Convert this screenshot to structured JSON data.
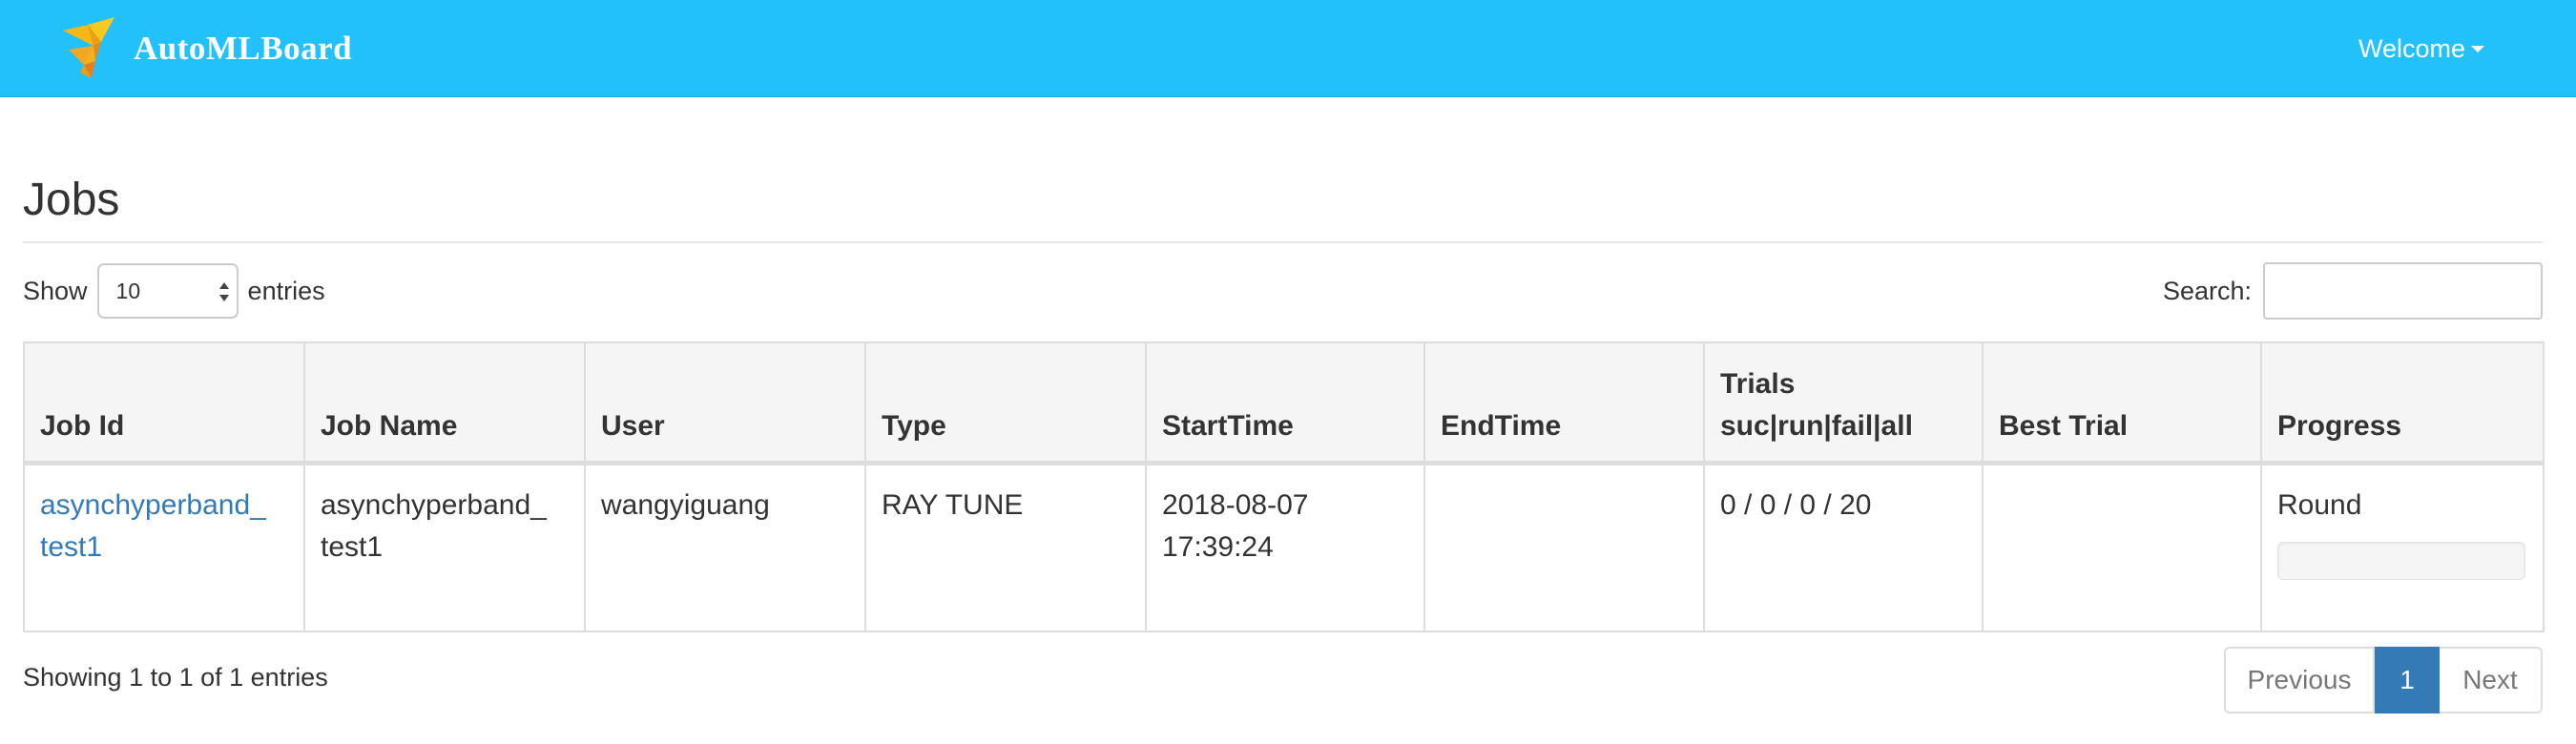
{
  "navbar": {
    "brand": "AutoMLBoard",
    "logo_icon": "paper-crane-icon",
    "welcome": "Welcome",
    "colors": {
      "background": "#22c1fb",
      "text": "#ffffff"
    }
  },
  "page": {
    "title": "Jobs"
  },
  "controls": {
    "show_label": "Show",
    "entries_value": "10",
    "entries_label": "entries",
    "search_label": "Search:",
    "search_value": ""
  },
  "table": {
    "headers": {
      "job_id": "Job Id",
      "job_name": "Job Name",
      "user": "User",
      "type": "Type",
      "start_time": "StartTime",
      "end_time": "EndTime",
      "trials_line1": "Trials",
      "trials_line2": "suc|run|fail|all",
      "best_trial": "Best Trial",
      "progress": "Progress"
    },
    "rows": [
      {
        "job_id_line1": "asynchyperband_",
        "job_id_line2": "test1",
        "job_name_line1": "asynchyperband_",
        "job_name_line2": "test1",
        "user": "wangyiguang",
        "type": "RAY TUNE",
        "start_date": "2018-08-07",
        "start_clock": "17:39:24",
        "end_time": "",
        "trials": "0 / 0 / 0 / 20",
        "best_trial": "",
        "progress_label": "Round",
        "progress_fraction": 0
      }
    ]
  },
  "footer": {
    "info": "Showing 1 to 1 of 1 entries",
    "previous": "Previous",
    "current_page": "1",
    "next": "Next",
    "colors": {
      "active": "#337ab7",
      "link": "#337ab7"
    }
  }
}
